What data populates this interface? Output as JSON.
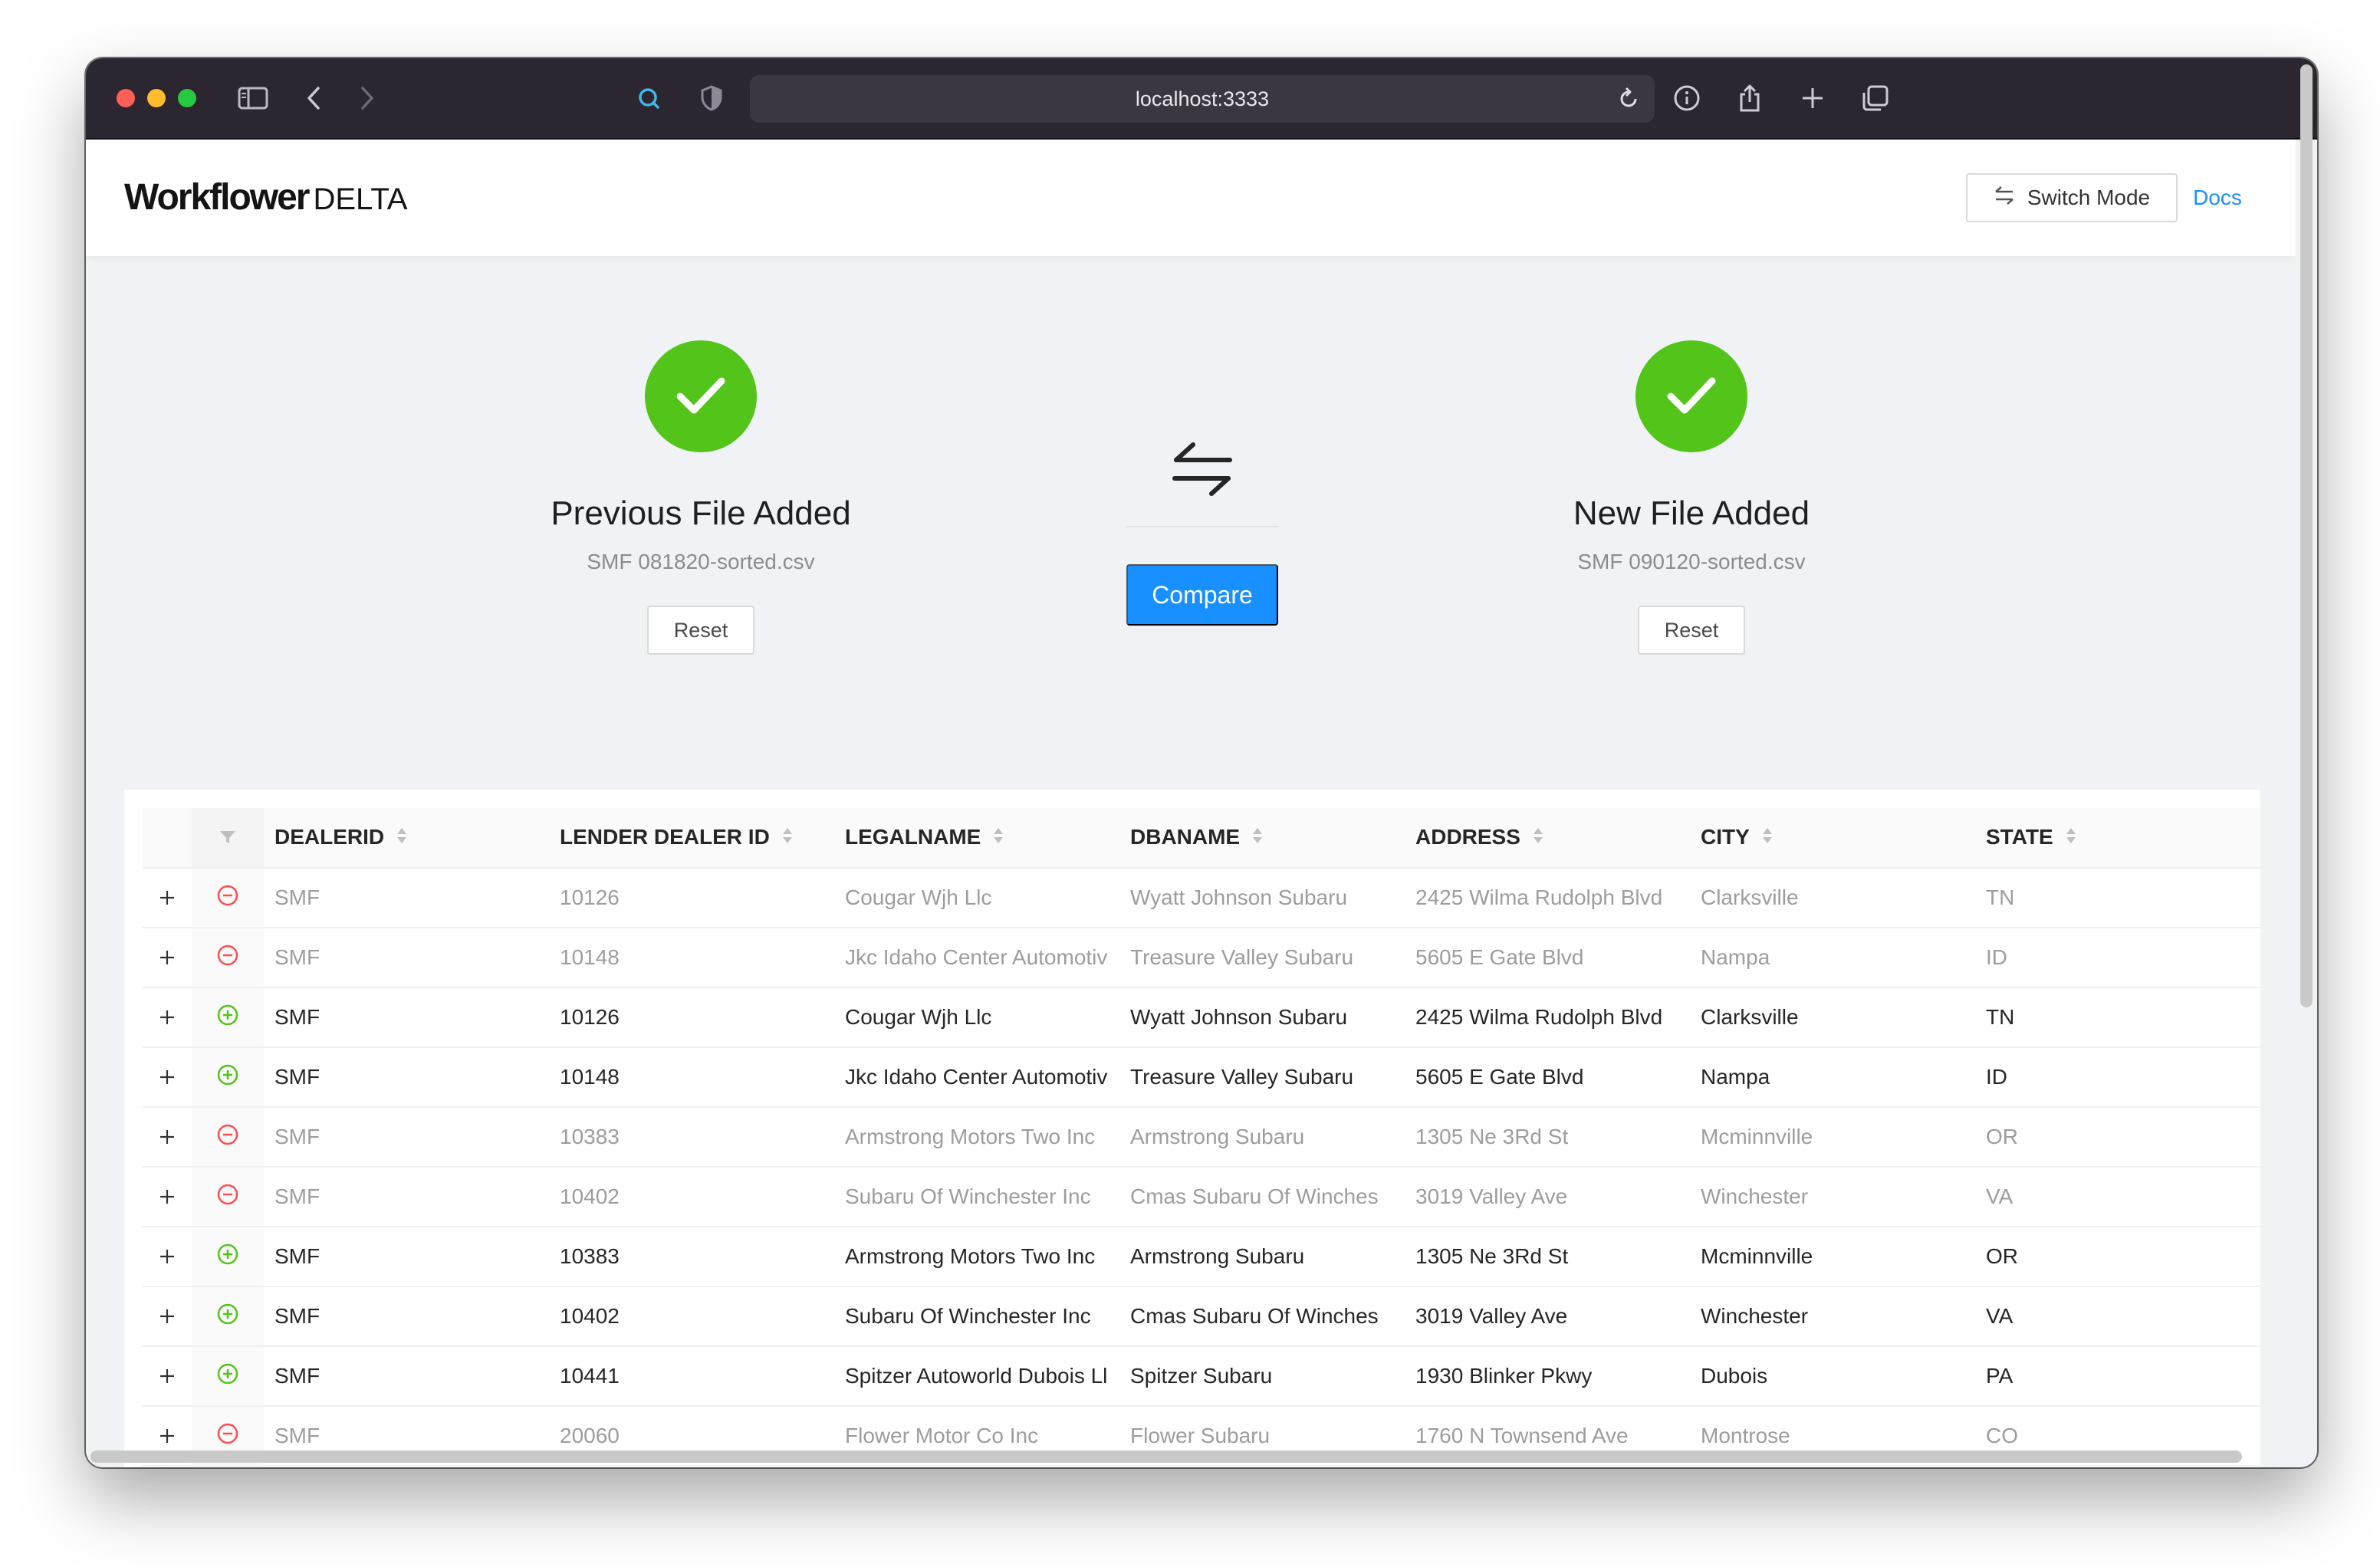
{
  "browser": {
    "url": "localhost:3333"
  },
  "header": {
    "brand": "Workflower",
    "brand_sub": "DELTA",
    "switch_mode_label": "Switch Mode",
    "docs_label": "Docs"
  },
  "previous_file": {
    "title": "Previous File Added",
    "filename": "SMF 081820-sorted.csv",
    "reset_label": "Reset"
  },
  "compare": {
    "button_label": "Compare"
  },
  "new_file": {
    "title": "New File Added",
    "filename": "SMF 090120-sorted.csv",
    "reset_label": "Reset"
  },
  "table": {
    "columns": [
      "DEALERID",
      "LENDER DEALER ID",
      "LEGALNAME",
      "DBANAME",
      "ADDRESS",
      "CITY",
      "STATE"
    ],
    "rows": [
      {
        "status": "removed",
        "cells": [
          "SMF",
          "10126",
          "Cougar Wjh Llc",
          "Wyatt Johnson Subaru",
          "2425 Wilma Rudolph Blvd",
          "Clarksville",
          "TN"
        ]
      },
      {
        "status": "removed",
        "cells": [
          "SMF",
          "10148",
          "Jkc Idaho Center Automotiv",
          "Treasure Valley Subaru",
          "5605 E Gate Blvd",
          "Nampa",
          "ID"
        ]
      },
      {
        "status": "added",
        "cells": [
          "SMF",
          "10126",
          "Cougar Wjh Llc",
          "Wyatt Johnson Subaru",
          "2425 Wilma Rudolph Blvd",
          "Clarksville",
          "TN"
        ]
      },
      {
        "status": "added",
        "cells": [
          "SMF",
          "10148",
          "Jkc Idaho Center Automotiv",
          "Treasure Valley Subaru",
          "5605 E Gate Blvd",
          "Nampa",
          "ID"
        ]
      },
      {
        "status": "removed",
        "cells": [
          "SMF",
          "10383",
          "Armstrong Motors Two Inc",
          "Armstrong Subaru",
          "1305 Ne 3Rd St",
          "Mcminnville",
          "OR"
        ]
      },
      {
        "status": "removed",
        "cells": [
          "SMF",
          "10402",
          "Subaru Of Winchester Inc",
          "Cmas Subaru Of Winches",
          "3019 Valley Ave",
          "Winchester",
          "VA"
        ]
      },
      {
        "status": "added",
        "cells": [
          "SMF",
          "10383",
          "Armstrong Motors Two Inc",
          "Armstrong Subaru",
          "1305 Ne 3Rd St",
          "Mcminnville",
          "OR"
        ]
      },
      {
        "status": "added",
        "cells": [
          "SMF",
          "10402",
          "Subaru Of Winchester Inc",
          "Cmas Subaru Of Winches",
          "3019 Valley Ave",
          "Winchester",
          "VA"
        ]
      },
      {
        "status": "added",
        "cells": [
          "SMF",
          "10441",
          "Spitzer Autoworld Dubois Ll",
          "Spitzer Subaru",
          "1930 Blinker Pkwy",
          "Dubois",
          "PA"
        ]
      },
      {
        "status": "removed",
        "cells": [
          "SMF",
          "20060",
          "Flower Motor Co Inc",
          "Flower Subaru",
          "1760 N Townsend Ave",
          "Montrose",
          "CO"
        ]
      }
    ]
  },
  "icons": {
    "success": "check-circle-icon",
    "swap": "swap-icon",
    "removed": "minus-circle-icon",
    "added": "plus-circle-icon",
    "expand": "plus-icon",
    "filter": "filter-icon",
    "sort": "sort-icon"
  },
  "colors": {
    "success": "#52c41a",
    "primary": "#1890ff",
    "removed": "#ff4d4f",
    "added": "#52c41a"
  }
}
